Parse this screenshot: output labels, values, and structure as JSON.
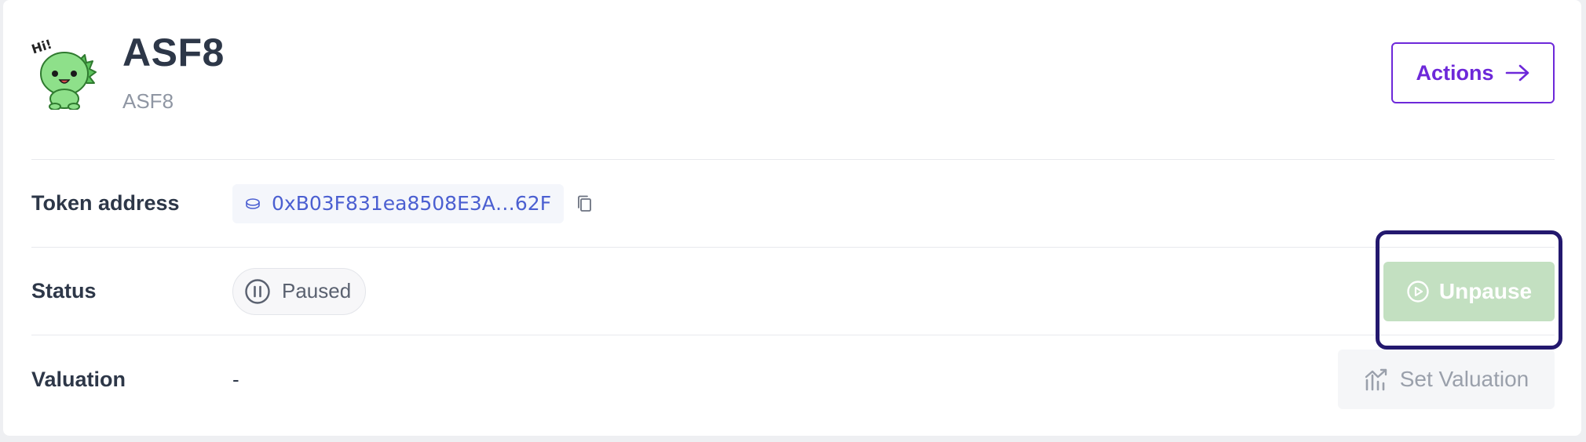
{
  "token": {
    "name": "ASF8",
    "symbol": "ASF8",
    "avatar_icon": "dino-hi-avatar",
    "avatar_text": "Hi!"
  },
  "actions": {
    "label": "Actions",
    "icon": "arrow-right-icon"
  },
  "rows": {
    "token_address": {
      "label": "Token address",
      "value": "0xB03F831ea8508E3A…62F",
      "icon": "coin-icon",
      "copy_icon": "copy-icon"
    },
    "status": {
      "label": "Status",
      "value": "Paused",
      "icon": "pause-circle-icon",
      "action_label": "Unpause",
      "action_icon": "play-circle-icon"
    },
    "valuation": {
      "label": "Valuation",
      "value": "-",
      "action_label": "Set Valuation",
      "action_icon": "chart-trend-icon"
    }
  },
  "colors": {
    "primary": "#6d28d9",
    "link": "#4b5fd1",
    "success_disabled": "#c3e0c1",
    "focus_ring": "#23186e"
  }
}
